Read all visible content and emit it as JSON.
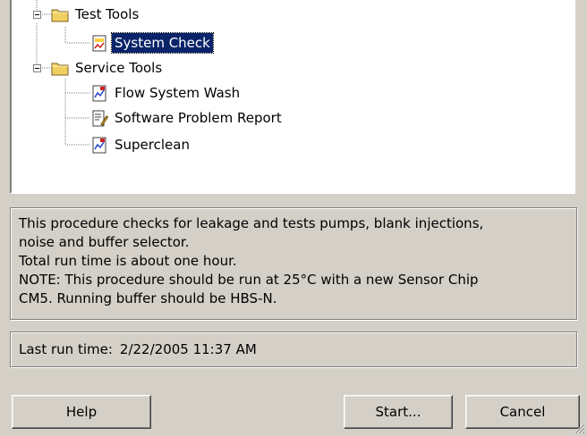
{
  "tree": {
    "items": [
      {
        "label": "Test Tools",
        "icon": "folder-icon"
      },
      {
        "label": "System Check",
        "icon": "system-check-icon",
        "selected": true
      },
      {
        "label": "Service Tools",
        "icon": "folder-icon"
      },
      {
        "label": "Flow System Wash",
        "icon": "procedure-icon"
      },
      {
        "label": "Software Problem Report",
        "icon": "report-icon"
      },
      {
        "label": "Superclean",
        "icon": "procedure-icon"
      }
    ]
  },
  "description": {
    "lines": [
      "This procedure checks for leakage and tests pumps, blank injections,",
      "noise and buffer selector.",
      "Total run time is about one hour.",
      "NOTE: This procedure should be run at 25°C with a new Sensor Chip",
      "CM5. Running buffer should be HBS-N."
    ]
  },
  "last_run": {
    "label": "Last run time:",
    "value": "2/22/2005 11:37 AM"
  },
  "buttons": {
    "help": "Help",
    "start": "Start...",
    "cancel": "Cancel"
  },
  "colors": {
    "window_bg": "#d4d0c8",
    "selection_bg": "#0a246a",
    "folder_yellow": "#f0d060"
  }
}
